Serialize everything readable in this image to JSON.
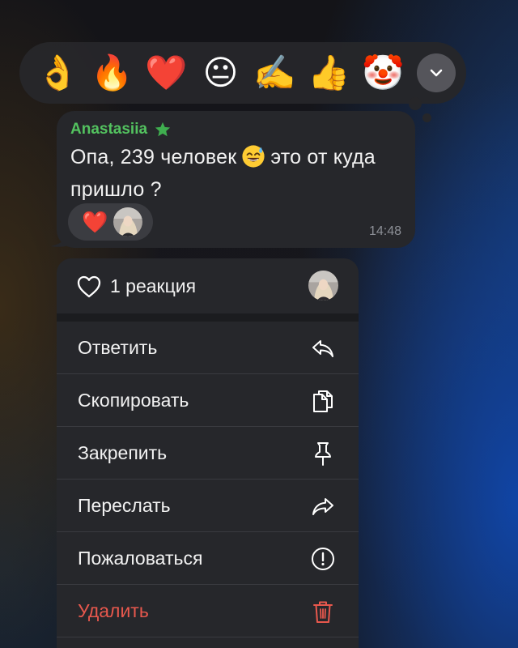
{
  "reaction_picker": {
    "emojis": [
      "👌",
      "🔥",
      "❤️",
      "😐",
      "✍️",
      "👍",
      "🤡"
    ],
    "expand_icon": "chevron-down-icon"
  },
  "message": {
    "sender": "Anastasiia",
    "sender_badge_icon": "star-icon",
    "text_part1": "Опа, 239 человек",
    "emoji": "😅",
    "text_part2": "это от куда",
    "text_line2": "пришло ?",
    "reaction": "❤️",
    "time": "14:48"
  },
  "menu": {
    "reactions_label": "1 реакция",
    "items": [
      {
        "label": "Ответить",
        "icon": "reply-icon"
      },
      {
        "label": "Скопировать",
        "icon": "copy-icon"
      },
      {
        "label": "Закрепить",
        "icon": "pin-icon"
      },
      {
        "label": "Переслать",
        "icon": "forward-icon"
      },
      {
        "label": "Пожаловаться",
        "icon": "report-icon"
      },
      {
        "label": "Удалить",
        "icon": "trash-icon"
      }
    ]
  },
  "colors": {
    "sender_name": "#53c25f",
    "destructive": "#e8584d",
    "menu_bg": "#26272b",
    "bubble_bg": "#26272b"
  }
}
